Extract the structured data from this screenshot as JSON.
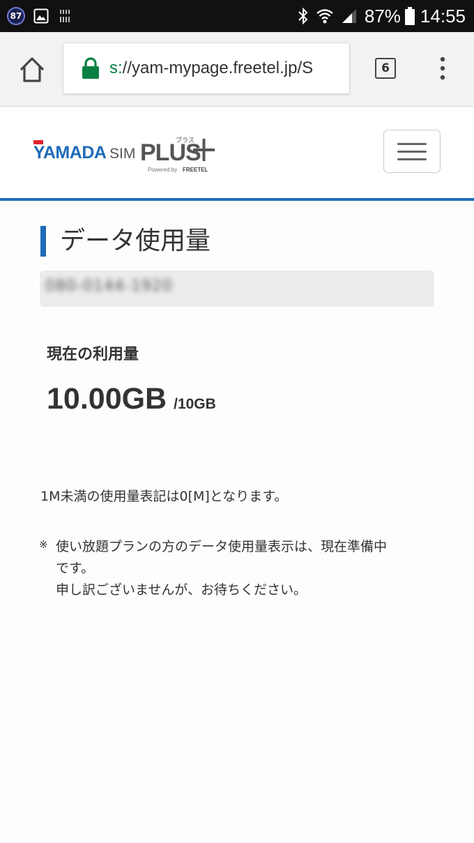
{
  "status_bar": {
    "badge": "87",
    "battery": "87%",
    "time": "14:55"
  },
  "browser": {
    "url_scheme": "s:",
    "url_rest": "//yam-mypage.freetel.jp/S",
    "tab_count": "6"
  },
  "header": {
    "logo_brand": "YAMADA",
    "logo_sim": "SIM",
    "logo_plus": "PLUS",
    "logo_ruby": "プラス",
    "logo_powered": "Powered by",
    "logo_freetel": "FREETEL"
  },
  "page": {
    "title": "データ使用量",
    "phone_number": "080-0144-1920",
    "usage_label": "現在の利用量",
    "usage_value": "10.00GB",
    "usage_limit": "/10GB",
    "note1": "1M未満の使用量表記は0[M]となります。",
    "note_mark": "※",
    "note2_line1": "使い放題プランの方のデータ使用量表示は、現在準備中",
    "note2_line2": "です。",
    "note2_line3": "申し訳ございませんが、お待ちください。"
  },
  "colors": {
    "accent_blue": "#1e6bb8",
    "lock_green": "#0b8043",
    "logo_red": "#e0252d"
  }
}
